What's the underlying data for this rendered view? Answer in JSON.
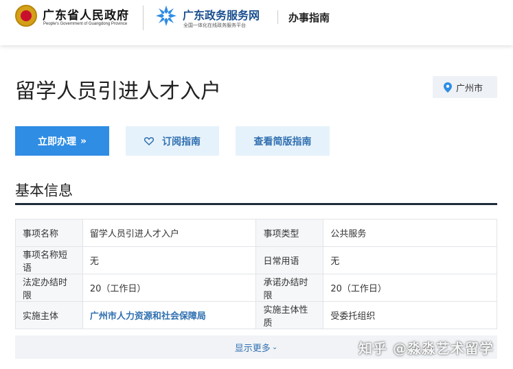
{
  "header": {
    "gov_title": "广东省人民政府",
    "gov_subtitle": "People's Government of Guangdong Province",
    "service_title": "广东政务服务网",
    "service_subtitle": "全国一体化在线政务服务平台",
    "page_section": "办事指南"
  },
  "item": {
    "title": "留学人员引进人才入户",
    "location": "广州市"
  },
  "actions": {
    "apply": "立即办理",
    "apply_suffix": "»",
    "subscribe": "订阅指南",
    "simple_guide": "查看简版指南"
  },
  "section": {
    "title": "基本信息"
  },
  "info_rows": [
    {
      "label1": "事项名称",
      "value1": "留学人员引进人才入户",
      "label2": "事项类型",
      "value2": "公共服务"
    },
    {
      "label1": "事项名称短语",
      "value1": "无",
      "label2": "日常用语",
      "value2": "无"
    },
    {
      "label1": "法定办结时限",
      "value1": "20（工作日）",
      "label2": "承诺办结时限",
      "value2": "20（工作日）"
    },
    {
      "label1": "实施主体",
      "value1": "广州市人力资源和社会保障局",
      "label2": "实施主体性质",
      "value2": "受委托组织"
    }
  ],
  "more": {
    "label": "显示更多",
    "caret": "⌄"
  },
  "watermark": "知乎 @淼淼艺术留学",
  "colors": {
    "primary": "#2f8de4",
    "link": "#2f6fb0",
    "light_button": "#e6f2fb",
    "section_line": "#1e2a3a"
  }
}
